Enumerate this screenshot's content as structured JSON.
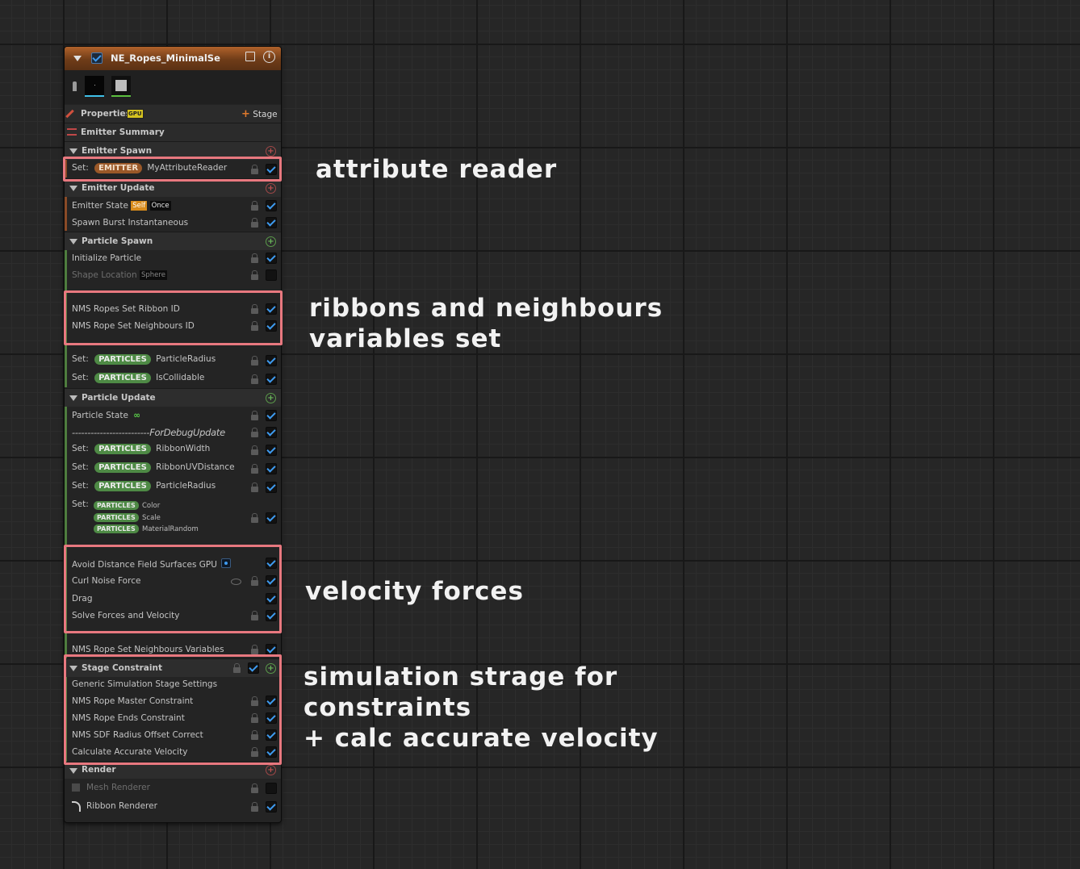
{
  "node": {
    "title": "NE_Ropes_MinimalSe",
    "properties": {
      "label": "Properties",
      "gpu_badge": "GPU",
      "stage_button": "Stage"
    },
    "emitter_summary": "Emitter Summary",
    "emitter_spawn": {
      "header": "Emitter Spawn",
      "set_row": {
        "set": "Set:",
        "namespace": "EMITTER",
        "variable": "MyAttributeReader"
      }
    },
    "emitter_update": {
      "header": "Emitter Update",
      "emitter_state": {
        "label": "Emitter State",
        "self": "Self",
        "once": "Once"
      },
      "spawn_burst": "Spawn Burst Instantaneous"
    },
    "particle_spawn": {
      "header": "Particle Spawn",
      "initialize": "Initialize Particle",
      "shape_location": {
        "label": "Shape Location",
        "tag": "Sphere"
      },
      "ribbon_id": "NMS Ropes Set Ribbon ID",
      "neighbours_id": "NMS Rope Set Neighbours ID",
      "set1": {
        "set": "Set:",
        "namespace": "PARTICLES",
        "variable": "ParticleRadius"
      },
      "set2": {
        "set": "Set:",
        "namespace": "PARTICLES",
        "variable": "IsCollidable"
      }
    },
    "particle_update": {
      "header": "Particle Update",
      "particle_state": {
        "label": "Particle State",
        "icon": "∞"
      },
      "debug": "-------------------------ForDebugUpdate",
      "set_width": {
        "set": "Set:",
        "namespace": "PARTICLES",
        "variable": "RibbonWidth"
      },
      "set_uv": {
        "set": "Set:",
        "namespace": "PARTICLES",
        "variable": "RibbonUVDistance"
      },
      "set_radius": {
        "set": "Set:",
        "namespace": "PARTICLES",
        "variable": "ParticleRadius"
      },
      "set_multi": {
        "set": "Set:",
        "items": [
          {
            "namespace": "PARTICLES",
            "variable": "Color"
          },
          {
            "namespace": "PARTICLES",
            "variable": "Scale"
          },
          {
            "namespace": "PARTICLES",
            "variable": "MaterialRandom"
          }
        ]
      },
      "avoid_sdf": "Avoid Distance Field Surfaces GPU",
      "curl_noise": "Curl Noise Force",
      "drag": "Drag",
      "solve_forces": "Solve Forces and Velocity",
      "neighbours_vars": "NMS Rope Set Neighbours Variables"
    },
    "stage_constraint": {
      "header": "Stage Constraint",
      "generic": "Generic Simulation Stage Settings",
      "master": "NMS Rope Master Constraint",
      "ends": "NMS Rope Ends Constraint",
      "sdf": "NMS SDF Radius Offset Correct",
      "accurate": "Calculate Accurate Velocity"
    },
    "render": {
      "header": "Render",
      "mesh": "Mesh Renderer",
      "ribbon": "Ribbon Renderer"
    }
  },
  "annotations": {
    "attribute_reader": "attribute reader",
    "ribbons_line1": "ribbons and neighbours",
    "ribbons_line2": "variables set",
    "velocity_forces": "velocity forces",
    "simulation_line1": "simulation strage for",
    "simulation_line2": "constraints",
    "simulation_line3": "+ calc accurate velocity"
  },
  "colors": {
    "highlight": "#e8787f",
    "emitter_accent": "#b0622b",
    "particles_pill": "#4e8a45",
    "checkbox_tick": "#3e9bf0"
  }
}
